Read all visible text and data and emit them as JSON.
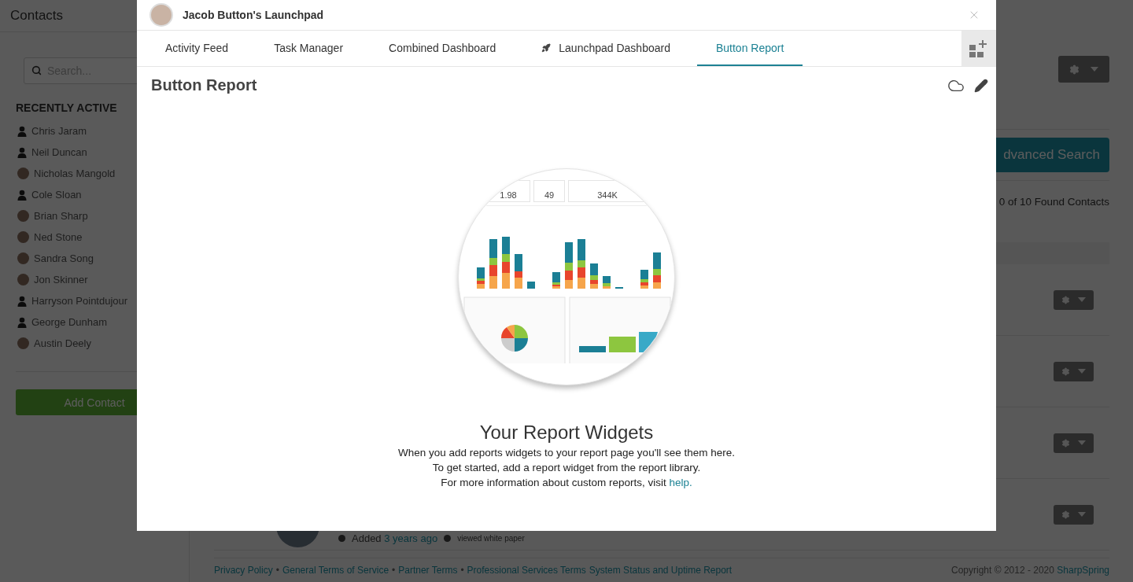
{
  "background_page": {
    "sidebar": {
      "title": "Contacts",
      "search": {
        "placeholder": "Search..."
      },
      "section_title": "RECENTLY ACTIVE",
      "contacts": [
        {
          "name": "Chris Jaram",
          "kind": "silhouette"
        },
        {
          "name": "Neil Duncan",
          "kind": "silhouette"
        },
        {
          "name": "Nicholas Mangold",
          "kind": "photo"
        },
        {
          "name": "Cole Sloan",
          "kind": "silhouette"
        },
        {
          "name": "Brian Sharp",
          "kind": "photo"
        },
        {
          "name": "Ned Stone",
          "kind": "photo"
        },
        {
          "name": "Sandra Song",
          "kind": "photo"
        },
        {
          "name": "Jon Skinner",
          "kind": "photo"
        },
        {
          "name": "Harryson Pointdujour",
          "kind": "silhouette"
        },
        {
          "name": "George Dunham",
          "kind": "silhouette"
        },
        {
          "name": "Austin Deely",
          "kind": "photo"
        }
      ],
      "add_button": "Add Contact"
    },
    "main": {
      "advanced_search_button": "dvanced Search",
      "found_count": "0 of 10 Found Contacts",
      "contact_rows": [
        {
          "has_actions_menu": true
        },
        {
          "has_actions_menu": true
        },
        {
          "has_actions_menu": true
        },
        {
          "has_actions_menu": true,
          "activity": {
            "prefix": "Added",
            "time": "3 years ago",
            "event": "viewed white paper"
          }
        }
      ]
    },
    "footer": {
      "items": [
        {
          "kind": "link",
          "text": "Privacy Policy"
        },
        {
          "kind": "bullet",
          "text": "•"
        },
        {
          "kind": "link",
          "text": "General Terms of Service"
        },
        {
          "kind": "bullet",
          "text": "•"
        },
        {
          "kind": "link",
          "text": "Partner Terms"
        },
        {
          "kind": "bullet",
          "text": "•"
        },
        {
          "kind": "link",
          "text": "Professional Services Terms"
        },
        {
          "kind": "link",
          "text": "System Status and Uptime Report"
        }
      ],
      "copyright": "Copyright © 2012 - 2020",
      "brand": "SharpSpring"
    }
  },
  "modal": {
    "title": "Jacob Button's Launchpad",
    "tabs": [
      {
        "label": "Activity Feed",
        "selected": false,
        "kind": "plain"
      },
      {
        "label": "Task Manager",
        "selected": false,
        "kind": "plain"
      },
      {
        "label": "Combined Dashboard",
        "selected": false,
        "kind": "plain"
      },
      {
        "label": "Launchpad Dashboard",
        "selected": false,
        "kind": "with_icon"
      },
      {
        "label": "Button Report",
        "selected": true,
        "kind": "plain"
      }
    ],
    "page_title": "Button Report",
    "preview_stats": [
      "1.98",
      "49",
      "344K"
    ],
    "empty_state": {
      "heading": "Your Report Widgets",
      "lines": [
        "When you add reports widgets to your report page you'll see them here.",
        "To get started, add a report widget from the report library."
      ],
      "last_line": "For more information about custom reports, visit",
      "link": "help."
    }
  }
}
